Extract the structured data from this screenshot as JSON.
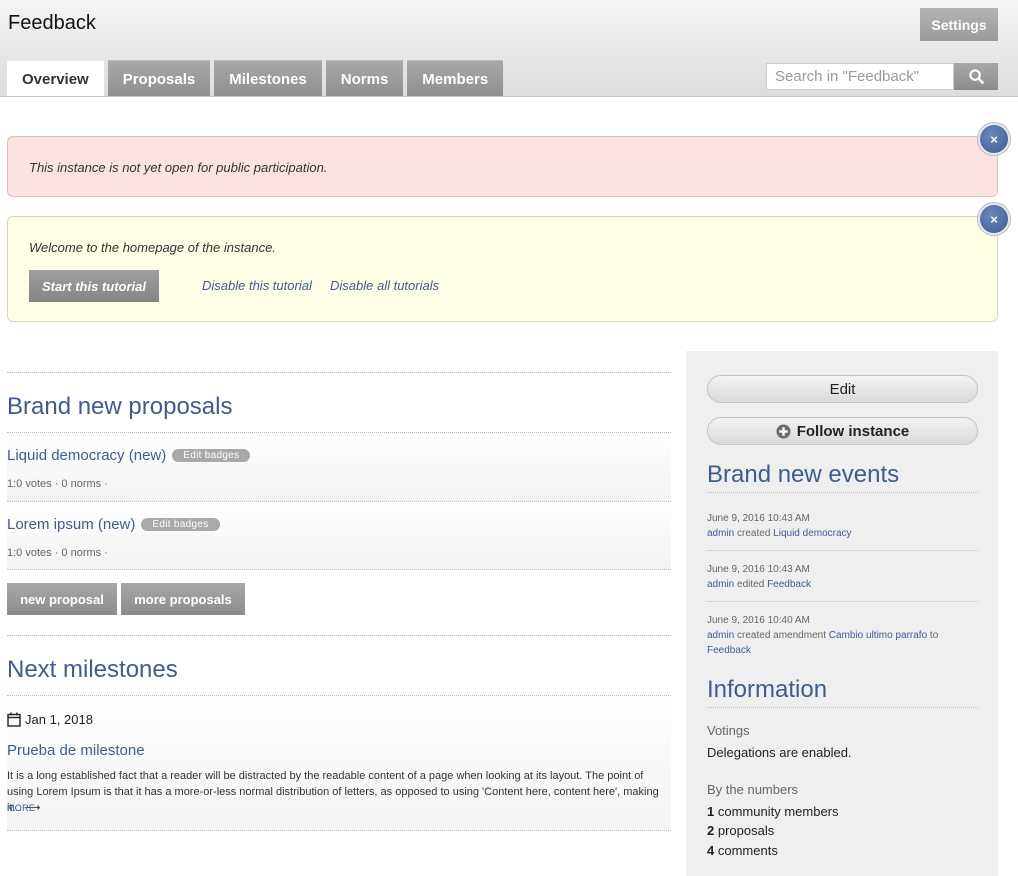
{
  "header": {
    "title": "Feedback",
    "settings_label": "Settings",
    "tabs": [
      {
        "label": "Overview",
        "active": true
      },
      {
        "label": "Proposals",
        "active": false
      },
      {
        "label": "Milestones",
        "active": false
      },
      {
        "label": "Norms",
        "active": false
      },
      {
        "label": "Members",
        "active": false
      }
    ],
    "search_placeholder": "Search in \"Feedback\""
  },
  "notices": {
    "public": "This instance is not yet open for public participation.",
    "welcome": "Welcome to the homepage of the instance.",
    "start_tutorial": "Start this tutorial",
    "disable_tutorial": "Disable this tutorial",
    "disable_all": "Disable all tutorials",
    "close_symbol": "×"
  },
  "proposals": {
    "title": "Brand new proposals",
    "items": [
      {
        "title": "Liquid democracy (new)",
        "badge": "Edit badges",
        "meta": "1:0 votes · 0 norms ·"
      },
      {
        "title": "Lorem ipsum (new)",
        "badge": "Edit badges",
        "meta": "1:0 votes · 0 norms ·"
      }
    ],
    "new_label": "new proposal",
    "more_label": "more proposals"
  },
  "milestones": {
    "title": "Next milestones",
    "date": "Jan 1, 2018",
    "item_title": "Prueba de milestone",
    "description": "It is a long established fact that a reader will be distracted by the readable content of a page when looking at its layout. The point of using Lorem Ipsum is that it has a more-or-less normal distribution of letters, as opposed to using 'Content here, content here', making it... ⟶",
    "more": "MORE"
  },
  "sidebar": {
    "edit_label": "Edit",
    "follow_label": "Follow instance",
    "events_title": "Brand new events",
    "events": [
      {
        "date": "June 9, 2016 10:43 AM",
        "actor": "admin",
        "action": "created",
        "target": "Liquid democracy",
        "suffix": "",
        "target2": ""
      },
      {
        "date": "June 9, 2016 10:43 AM",
        "actor": "admin",
        "action": "edited",
        "target": "Feedback",
        "suffix": "",
        "target2": ""
      },
      {
        "date": "June 9, 2016 10:40 AM",
        "actor": "admin",
        "action": "created amendment",
        "target": "Cambio ultimo parrafo",
        "suffix": "to",
        "target2": "Feedback"
      }
    ],
    "info_title": "Information",
    "votings_label": "Votings",
    "votings_text": "Delegations are enabled.",
    "numbers_label": "By the numbers",
    "stats": [
      {
        "num": "1",
        "label": "community members"
      },
      {
        "num": "2",
        "label": "proposals"
      },
      {
        "num": "4",
        "label": "comments"
      }
    ]
  },
  "colors": {
    "accent": "#3f5c8e",
    "close_button": "#3b5a98",
    "notice_pink": "#fde2e2",
    "notice_yellow": "#fefde6"
  }
}
